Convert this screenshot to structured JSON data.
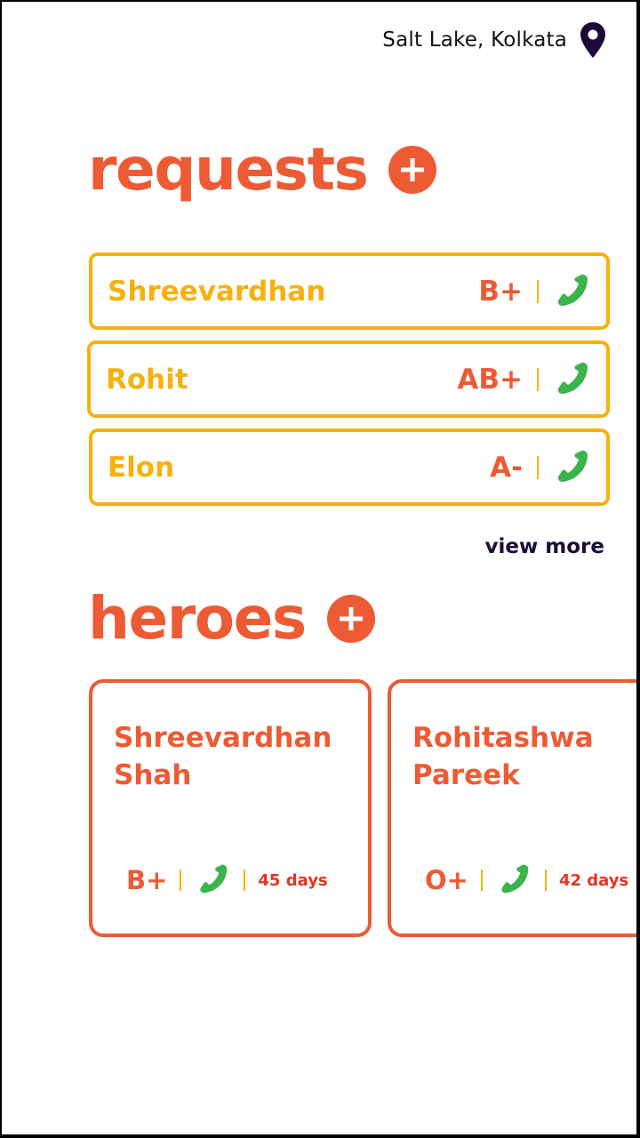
{
  "location": {
    "text": "Salt Lake, Kolkata",
    "icon": "location-pin-icon"
  },
  "requests": {
    "title": "requests",
    "items": [
      {
        "name": "Shreevardhan",
        "blood_group": "B+"
      },
      {
        "name": "Rohit",
        "blood_group": "AB+"
      },
      {
        "name": "Elon",
        "blood_group": "A-"
      }
    ],
    "view_more": "view more"
  },
  "heroes": {
    "title": "heroes",
    "items": [
      {
        "first_name": "Shreevardhan",
        "last_name": "Shah",
        "blood_group": "B+",
        "days": "45 days"
      },
      {
        "first_name": "Rohitashwa",
        "last_name": "Pareek",
        "blood_group": "O+",
        "days": "42 days"
      }
    ]
  },
  "colors": {
    "accent": "#ec5b34",
    "request_border": "#f6b10e",
    "phone": "#3cb44b",
    "dark": "#1a0b3a"
  }
}
